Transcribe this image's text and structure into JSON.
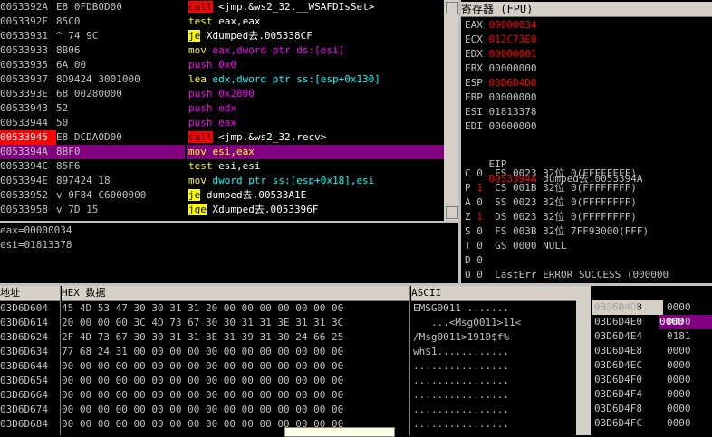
{
  "disasm": {
    "rows": [
      {
        "addr": "0053392A",
        "bytes": "E8 0FDB0D00",
        "kw": "call",
        "kwc": "kw-call",
        "ops": " <jmp.&ws2_32.__WSAFDIsSet>",
        "opc": "op-white",
        "cls": ""
      },
      {
        "addr": "0053392F",
        "bytes": "85C0",
        "kw": "test",
        "kwc": "kw-test",
        "ops": " eax,eax",
        "opc": "op-white",
        "cls": ""
      },
      {
        "addr": "00533931",
        "bytes": "^ 74 9C",
        "kw": "je",
        "kwc": "kw-je",
        "ops": " Xdumped去.005338CF",
        "opc": "op-white",
        "cls": ""
      },
      {
        "addr": "00533933",
        "bytes": "8B06",
        "kw": "mov",
        "kwc": "kw-mov",
        "ops": " eax,dword ptr ds:[esi]",
        "opc": "op-mag",
        "cls": ""
      },
      {
        "addr": "00533935",
        "bytes": "6A 00",
        "kw": "push",
        "kwc": "kw-push",
        "ops": " 0x0",
        "opc": "op-mag",
        "cls": ""
      },
      {
        "addr": "00533937",
        "bytes": "8D9424 3001000",
        "kw": "lea",
        "kwc": "kw-lea",
        "ops": " edx,dword ptr ss:[esp+0x130]",
        "opc": "op-cyan",
        "cls": ""
      },
      {
        "addr": "0053393E",
        "bytes": "68 00280000",
        "kw": "push",
        "kwc": "kw-push",
        "ops": " 0x2800",
        "opc": "op-mag",
        "cls": ""
      },
      {
        "addr": "00533943",
        "bytes": "52",
        "kw": "push",
        "kwc": "kw-push",
        "ops": " edx",
        "opc": "op-mag",
        "cls": ""
      },
      {
        "addr": "00533944",
        "bytes": "50",
        "kw": "push",
        "kwc": "kw-push",
        "ops": " eax",
        "opc": "op-mag",
        "cls": ""
      },
      {
        "addr": "00533945",
        "bytes": "E8 DCDA0D00",
        "kw": "call",
        "kwc": "kw-call",
        "ops": " <jmp.&ws2_32.recv>",
        "opc": "op-white",
        "cls": "bp"
      },
      {
        "addr": "0053394A",
        "bytes": "8BF0",
        "kw": "mov",
        "kwc": "kw-mov",
        "ops": " esi,eax",
        "opc": "op-white",
        "cls": "sel"
      },
      {
        "addr": "0053394C",
        "bytes": "85F6",
        "kw": "test",
        "kwc": "kw-test",
        "ops": " esi,esi",
        "opc": "op-white",
        "cls": ""
      },
      {
        "addr": "0053394E",
        "bytes": "897424 18",
        "kw": "mov",
        "kwc": "kw-mov",
        "ops": " dword ptr ss:[esp+0x18],esi",
        "opc": "op-cyan",
        "cls": ""
      },
      {
        "addr": "00533952",
        "bytes": "v 0F84 C6000000",
        "kw": "je",
        "kwc": "kw-je",
        "ops": " dumped去.00533A1E",
        "opc": "op-white",
        "cls": ""
      },
      {
        "addr": "00533958",
        "bytes": "v 7D 15",
        "kw": "jge",
        "kwc": "kw-je",
        "ops": " Xdumped去.0053396F",
        "opc": "op-white",
        "cls": ""
      }
    ],
    "info": [
      "eax=00000034",
      "esi=01813378"
    ]
  },
  "registers": {
    "header": "寄存器 (FPU)",
    "gp": [
      {
        "n": "EAX",
        "v": "00000034",
        "red": true
      },
      {
        "n": "ECX",
        "v": "012C73E0",
        "red": true
      },
      {
        "n": "EDX",
        "v": "00000001",
        "red": true
      },
      {
        "n": "EBX",
        "v": "00000000",
        "red": false
      },
      {
        "n": "ESP",
        "v": "03D6D4D8",
        "red": true
      },
      {
        "n": "EBP",
        "v": "00000000",
        "red": false
      },
      {
        "n": "ESI",
        "v": "01813378",
        "red": false
      },
      {
        "n": "EDI",
        "v": "00000000",
        "red": false
      }
    ],
    "eip": {
      "n": "EIP",
      "v": "0053394A",
      "extra": " dumped去.0053394A"
    },
    "flags": [
      {
        "f": "C",
        "b": "0",
        "rest": "  ES 0023 32位 0(FFFFFFFF)",
        "red": false
      },
      {
        "f": "P",
        "b": "1",
        "rest": "  CS 001B 32位 0(FFFFFFFF)",
        "red": true
      },
      {
        "f": "A",
        "b": "0",
        "rest": "  SS 0023 32位 0(FFFFFFFF)",
        "red": false
      },
      {
        "f": "Z",
        "b": "1",
        "rest": "  DS 0023 32位 0(FFFFFFFF)",
        "red": true
      },
      {
        "f": "S",
        "b": "0",
        "rest": "  FS 003B 32位 7FF93000(FFF)",
        "red": false
      },
      {
        "f": "T",
        "b": "0",
        "rest": "  GS 0000 NULL",
        "red": false
      },
      {
        "f": "D",
        "b": "0",
        "rest": "",
        "red": false
      },
      {
        "f": "O",
        "b": "0",
        "rest": "  LastErr ERROR_SUCCESS (000000",
        "red": false
      }
    ]
  },
  "dump": {
    "col_addr": "地址",
    "col_hex": "HEX 数据",
    "col_ascii": "ASCII",
    "rows": [
      {
        "a": "03D6D604",
        "h": "45 4D 53 47 30 30 31 31 20 00 00 00 00 00 00 00",
        "t": "EMSG0011 ......."
      },
      {
        "a": "03D6D614",
        "h": "20 00 00 00 3C 4D 73 67 30 30 31 31 3E 31 31 3C",
        "t": "   ...<Msg0011>11<"
      },
      {
        "a": "03D6D624",
        "h": "2F 4D 73 67 30 30 31 31 3E 31 39 31 30 24 66 25",
        "t": "/Msg0011>1910$f%"
      },
      {
        "a": "03D6D634",
        "h": "77 68 24 31 00 00 00 00 00 00 00 00 00 00 00 00",
        "t": "wh$1............"
      },
      {
        "a": "03D6D644",
        "h": "00 00 00 00 00 00 00 00 00 00 00 00 00 00 00 00",
        "t": "................"
      },
      {
        "a": "03D6D654",
        "h": "00 00 00 00 00 00 00 00 00 00 00 00 00 00 00 00",
        "t": "................"
      },
      {
        "a": "03D6D664",
        "h": "00 00 00 00 00 00 00 00 00 00 00 00 00 00 00 00",
        "t": "................"
      },
      {
        "a": "03D6D674",
        "h": "00 00 00 00 00 00 00 00 00 00 00 00 00 00 00 00",
        "t": "................"
      },
      {
        "a": "03D6D684",
        "h": "00 00 00 00 00 00 00 00 00 00 00 00 00 00 00 00",
        "t": "................"
      }
    ]
  },
  "stack": {
    "top_addr": "03D6D4D8",
    "top_val": "0000",
    "rows": [
      {
        "a": "03D6D4DC",
        "v": "0000"
      },
      {
        "a": "03D6D4E0",
        "v": "0000"
      },
      {
        "a": "03D6D4E4",
        "v": "0181"
      },
      {
        "a": "03D6D4E8",
        "v": "0000"
      },
      {
        "a": "03D6D4EC",
        "v": "0000"
      },
      {
        "a": "03D6D4F0",
        "v": "0000"
      },
      {
        "a": "03D6D4F4",
        "v": "0000"
      },
      {
        "a": "03D6D4F8",
        "v": "0000"
      },
      {
        "a": "03D6D4FC",
        "v": "0000"
      }
    ]
  }
}
